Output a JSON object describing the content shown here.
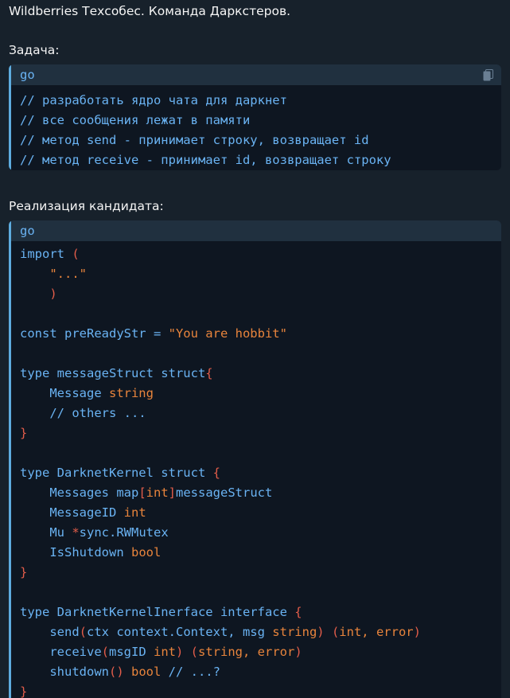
{
  "title": "Wildberries Техсобес. Команда Даркстеров.",
  "task_label": "Задача:",
  "impl_label": "Реализация кандидата:",
  "block1": {
    "lang": "go",
    "lines": [
      [
        {
          "t": "// разработать ядро чата для даркнет",
          "c": "comment"
        }
      ],
      [
        {
          "t": "// все сообщения лежат в памяти",
          "c": "comment"
        }
      ],
      [
        {
          "t": "// метод send - принимает строку, возвращает id",
          "c": "comment"
        }
      ],
      [
        {
          "t": "// метод receive - принимает id, возвращает строку",
          "c": "comment"
        }
      ]
    ]
  },
  "block2": {
    "lang": "go",
    "lines": [
      [
        {
          "t": "import ",
          "c": "kw"
        },
        {
          "t": "(",
          "c": "punct"
        }
      ],
      [
        {
          "t": "    \"...\"",
          "c": "str"
        }
      ],
      [
        {
          "t": "    )",
          "c": "punct"
        }
      ],
      [
        {
          "t": "",
          "c": "plain"
        }
      ],
      [
        {
          "t": "const preReadyStr = ",
          "c": "plain"
        },
        {
          "t": "\"You are hobbit\"",
          "c": "str"
        }
      ],
      [
        {
          "t": "",
          "c": "plain"
        }
      ],
      [
        {
          "t": "type messageStruct struct",
          "c": "kw"
        },
        {
          "t": "{",
          "c": "punct"
        }
      ],
      [
        {
          "t": "    Message ",
          "c": "plain"
        },
        {
          "t": "string",
          "c": "type"
        }
      ],
      [
        {
          "t": "    // others ...",
          "c": "comment"
        }
      ],
      [
        {
          "t": "}",
          "c": "punct"
        }
      ],
      [
        {
          "t": "",
          "c": "plain"
        }
      ],
      [
        {
          "t": "type DarknetKernel struct ",
          "c": "kw"
        },
        {
          "t": "{",
          "c": "punct"
        }
      ],
      [
        {
          "t": "    Messages map",
          "c": "plain"
        },
        {
          "t": "[",
          "c": "punct"
        },
        {
          "t": "int",
          "c": "type"
        },
        {
          "t": "]",
          "c": "punct"
        },
        {
          "t": "messageStruct",
          "c": "plain"
        }
      ],
      [
        {
          "t": "    MessageID ",
          "c": "plain"
        },
        {
          "t": "int",
          "c": "type"
        }
      ],
      [
        {
          "t": "    Mu ",
          "c": "plain"
        },
        {
          "t": "*",
          "c": "punct"
        },
        {
          "t": "sync.RWMutex",
          "c": "plain"
        }
      ],
      [
        {
          "t": "    IsShutdown ",
          "c": "plain"
        },
        {
          "t": "bool",
          "c": "type"
        }
      ],
      [
        {
          "t": "}",
          "c": "punct"
        }
      ],
      [
        {
          "t": "",
          "c": "plain"
        }
      ],
      [
        {
          "t": "type DarknetKernelInerface interface ",
          "c": "kw"
        },
        {
          "t": "{",
          "c": "punct"
        }
      ],
      [
        {
          "t": "    send",
          "c": "plain"
        },
        {
          "t": "(",
          "c": "punct"
        },
        {
          "t": "ctx context.Context, msg ",
          "c": "plain"
        },
        {
          "t": "string",
          "c": "type"
        },
        {
          "t": ") (",
          "c": "punct"
        },
        {
          "t": "int, error",
          "c": "type"
        },
        {
          "t": ")",
          "c": "punct"
        }
      ],
      [
        {
          "t": "    receive",
          "c": "plain"
        },
        {
          "t": "(",
          "c": "punct"
        },
        {
          "t": "msgID ",
          "c": "plain"
        },
        {
          "t": "int",
          "c": "type"
        },
        {
          "t": ") (",
          "c": "punct"
        },
        {
          "t": "string, error",
          "c": "type"
        },
        {
          "t": ")",
          "c": "punct"
        }
      ],
      [
        {
          "t": "    shutdown",
          "c": "plain"
        },
        {
          "t": "() ",
          "c": "punct"
        },
        {
          "t": "bool",
          "c": "type"
        },
        {
          "t": " // ...?",
          "c": "comment"
        }
      ],
      [
        {
          "t": "}",
          "c": "punct"
        }
      ]
    ]
  },
  "colors": {
    "background": "#17212b",
    "code_background": "#0e1621",
    "code_header": "#20303f",
    "accent_blue": "#6ab3f3",
    "string_orange": "#e8843c",
    "punct_red": "#e35d4a"
  },
  "icons": {
    "copy": "copy-icon"
  }
}
